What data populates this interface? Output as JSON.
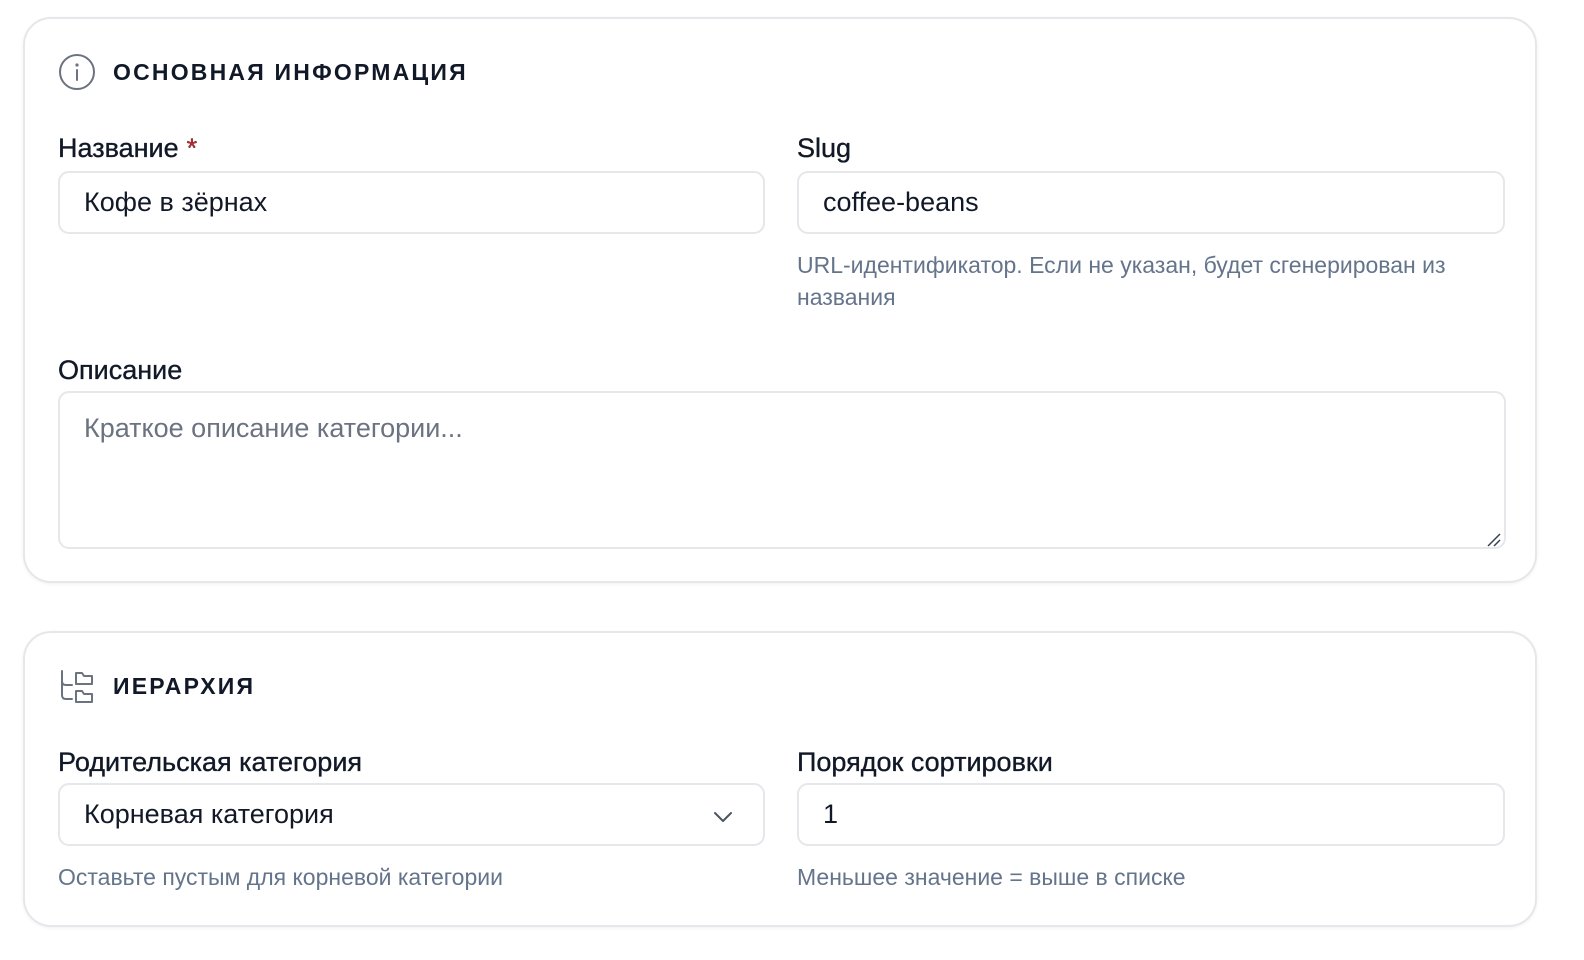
{
  "basic_section": {
    "title": "ОСНОВНАЯ ИНФОРМАЦИЯ",
    "icon": "info-icon",
    "name_field": {
      "label": "Название",
      "required_mark": "*",
      "value": "Кофе в зёрнах"
    },
    "slug_field": {
      "label": "Slug",
      "value": "coffee-beans",
      "hint": "URL-идентификатор. Если не указан, будет сгенерирован из названия"
    },
    "description_field": {
      "label": "Описание",
      "placeholder": "Краткое описание категории..."
    }
  },
  "hierarchy_section": {
    "title": "ИЕРАРХИЯ",
    "icon": "folder-tree-icon",
    "parent_field": {
      "label": "Родительская категория",
      "selected": "Корневая категория",
      "hint": "Оставьте пустым для корневой категории"
    },
    "sort_field": {
      "label": "Порядок сортировки",
      "value": "1",
      "hint": "Меньшее значение = выше в списке"
    }
  },
  "colors": {
    "border": "#e5e7eb",
    "text": "#111827",
    "muted": "#64748b",
    "required": "#dc2626"
  }
}
